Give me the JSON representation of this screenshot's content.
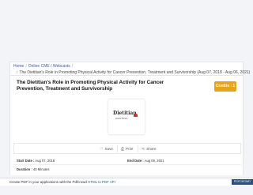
{
  "breadcrumb": {
    "items": [
      "Home",
      "Online CME / Webcasts"
    ],
    "current": "The Dietitian's Role in Promoting Physical Activity for Cancer Prevention, Treatment and Survivorship (Aug 07, 2018 - Aug 06, 2021)"
  },
  "course": {
    "title": "The Dietitian's Role in Promoting Physical Activity for Cancer Prevention, Treatment and Survivorship",
    "credits_label": "Credits : 1",
    "logo_text": "Dietitian",
    "logo_subtext": "CENTRAL"
  },
  "actions": {
    "save": "Save",
    "print": "Print",
    "share": "Share"
  },
  "meta": {
    "start_label": "Start Date :",
    "start_value": "Aug 07, 2018",
    "end_label": "End Date :",
    "end_value": "Aug 06, 2021",
    "duration_label": "Duration :",
    "duration_value": "40 Minutes"
  },
  "footer": {
    "text_before": "Create PDF in your applications with the Pdfcrowd",
    "link": "HTML to PDF API",
    "badge": "PDFCROWD"
  },
  "colors": {
    "accent": "#e8a21c",
    "link": "#3b5b9a"
  }
}
